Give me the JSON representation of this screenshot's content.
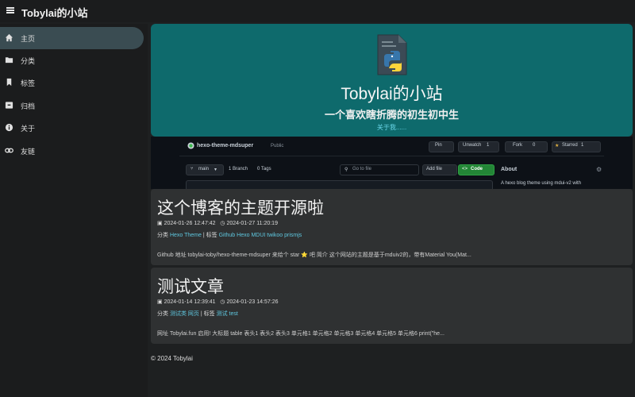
{
  "header": {
    "site_title": "Tobylai的小站"
  },
  "sidebar": {
    "items": [
      {
        "label": "主页",
        "icon": "home-icon",
        "active": true
      },
      {
        "label": "分类",
        "icon": "folder-icon",
        "active": false
      },
      {
        "label": "标签",
        "icon": "bookmark-icon",
        "active": false
      },
      {
        "label": "归档",
        "icon": "archive-icon",
        "active": false
      },
      {
        "label": "关于",
        "icon": "info-icon",
        "active": false
      },
      {
        "label": "友链",
        "icon": "link-icon",
        "active": false
      }
    ]
  },
  "hero": {
    "title": "Tobylai的小站",
    "subtitle": "一个喜欢瞎折腾的初生初中生",
    "about_link": "关于我......",
    "background_color": "#0e6a6c",
    "icon": "python-file-icon"
  },
  "github_preview": {
    "repo_name": "hexo-theme-mdsuper",
    "visibility": "Public",
    "pin": "Pin",
    "unwatch": "Unwatch",
    "unwatch_count": "1",
    "fork": "Fork",
    "fork_count": "0",
    "starred": "Starred",
    "starred_count": "1",
    "branch": "main",
    "branches": "1 Branch",
    "tags": "0 Tags",
    "goto_file": "Go to file",
    "add_file": "Add file",
    "code_button": "Code",
    "about_heading": "About",
    "about_text": "A hexo blog theme using mdui-v2 with"
  },
  "posts": [
    {
      "title": "这个博客的主题开源啦",
      "created": "2024-01-26 12:47:42",
      "updated": "2024-01-27 11:20:19",
      "category_prefix": "分类",
      "categories": [
        "Hexo Theme"
      ],
      "tag_prefix": "标签",
      "tags": [
        "Github",
        "Hexo",
        "MDUI",
        "twikoo",
        "prismjs"
      ],
      "excerpt": "Github 地址 tobylai-toby/hexo-theme-mdsuper 来给个 star ⭐ 吧 简介 这个网站的主题是基于mduiv2的，带有Material You(Mat..."
    },
    {
      "title": "测试文章",
      "created": "2024-01-14 12:39:41",
      "updated": "2024-01-23 14:57:26",
      "category_prefix": "分类",
      "categories": [
        "测试类",
        "网页"
      ],
      "tag_prefix": "标签",
      "tags": [
        "测试",
        "test"
      ],
      "excerpt": "网址 Tobylai.fun 启用!   大标题 table 表头1 表头2 表头3 单元格1 单元格2 单元格3 单元格4 单元格5 单元格6 print(\"he..."
    }
  ],
  "footer": {
    "copyright": "© 2024 Tobylai"
  },
  "colors": {
    "accent_link": "#5fc8e0",
    "active_nav": "#3a4c52",
    "card_bg": "#2f3132",
    "github_green": "#238636"
  }
}
